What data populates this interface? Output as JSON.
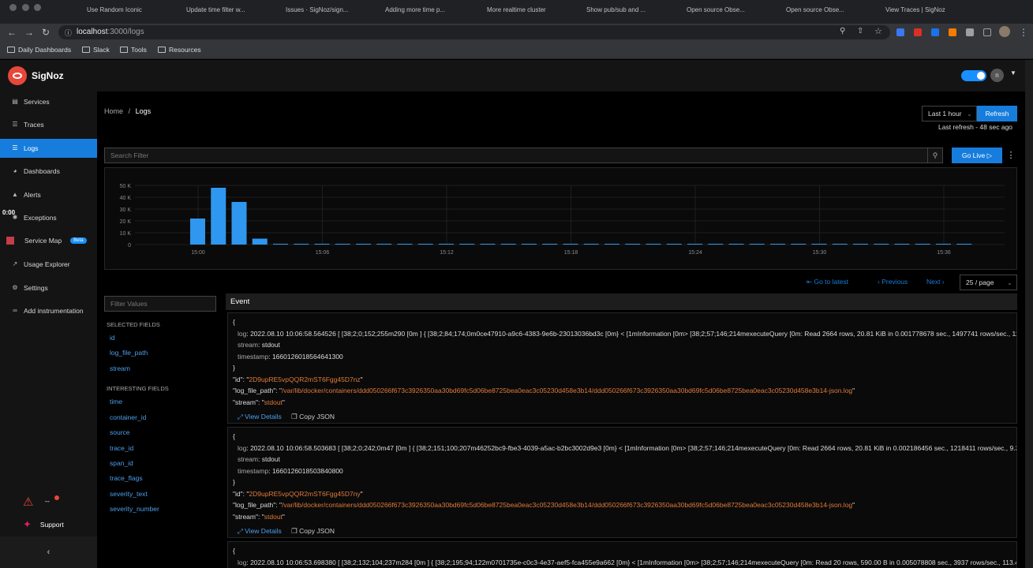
{
  "browser": {
    "tabs": [
      "Use Random Iconic",
      "Update time filter w...",
      "Issues · SigNoz/sign...",
      "Adding more time p...",
      "More realtime cluster",
      "Show pub/sub and ...",
      "Open source Obse...",
      "Open source Obse...",
      "View Traces | SigNoz"
    ],
    "url_host": "localhost",
    "url_path": ":3000/logs",
    "bookmarks": [
      "Daily Dashboards",
      "Slack",
      "Tools",
      "Resources"
    ]
  },
  "app": {
    "brand": "SigNoz",
    "nav": [
      {
        "label": "Services",
        "icon": "bar-chart-icon"
      },
      {
        "label": "Traces",
        "icon": "list-icon"
      },
      {
        "label": "Logs",
        "icon": "list-icon"
      },
      {
        "label": "Dashboards",
        "icon": "dashboard-icon"
      },
      {
        "label": "Alerts",
        "icon": "bell-icon"
      },
      {
        "label": "Exceptions",
        "icon": "bug-icon"
      },
      {
        "label": "Service Map",
        "icon": "map-icon",
        "badge": "Beta"
      },
      {
        "label": "Usage Explorer",
        "icon": "line-chart-icon"
      },
      {
        "label": "Settings",
        "icon": "settings-icon"
      },
      {
        "label": "Add instrumentation",
        "icon": "api-icon"
      }
    ],
    "active_nav": "Logs",
    "alert_status": "--",
    "support_label": "Support",
    "recording_time": "0:00",
    "avatar_initial": "n"
  },
  "header": {
    "breadcrumb_home": "Home",
    "breadcrumb_current": "Logs",
    "time_range": "Last 1 hour",
    "refresh_label": "Refresh",
    "last_refresh": "Last refresh - 48 sec ago"
  },
  "search": {
    "placeholder": "Search Filter",
    "go_live": "Go Live"
  },
  "chart_data": {
    "type": "bar",
    "y_ticks": [
      "50 K",
      "40 K",
      "30 K",
      "20 K",
      "10 K",
      "0"
    ],
    "x_ticks": [
      "15:00",
      "15:06",
      "15:12",
      "15:18",
      "15:24",
      "15:30",
      "15:36"
    ],
    "ylim": [
      0,
      50000
    ],
    "values": [
      22000,
      48000,
      36000,
      5000,
      500,
      500,
      500,
      500,
      500,
      500,
      500,
      500,
      500,
      500,
      500,
      500,
      500,
      500,
      500,
      500,
      500,
      500,
      500,
      500,
      500,
      500,
      500,
      500,
      500,
      500,
      500,
      500,
      500,
      500,
      500,
      500,
      500,
      500
    ],
    "color": "#2f97f0"
  },
  "pagination": {
    "go_to_latest": "Go to latest",
    "previous": "Previous",
    "next": "Next",
    "page_size": "25 / page"
  },
  "fields": {
    "filter_placeholder": "Filter Values",
    "selected_heading": "SELECTED FIELDS",
    "selected": [
      "id",
      "log_file_path",
      "stream"
    ],
    "interesting_heading": "INTERESTING FIELDS",
    "interesting": [
      "time",
      "container_id",
      "source",
      "trace_id",
      "span_id",
      "trace_flags",
      "severity_text",
      "severity_number"
    ]
  },
  "events": {
    "header": "Event",
    "view_details": "View Details",
    "copy_json": "Copy JSON",
    "items": [
      {
        "log": "2022.08.10 10:06:58.564526 [  [38;2;0;152;255m290 [0m ] { [38;2;84;174;0m0ce47910-a9c6-4383-9e6b-23013036bd3c [0m} < [1mInformation [0m>  [38;2;57;146;214mexecuteQuery [0m: Read 2664 rows, 20.81 KiB in 0.001778678 sec., 1497741 rows/sec., 11.43 MiB/sec.",
        "stream": "stdout",
        "timestamp": "1660126018564641300",
        "id": "2D9upRE5vpQQR2mST6Fgg45D7nz",
        "log_file_path": "/var/lib/docker/containers/ddd050266f673c3926350aa30bd69fc5d06be8725bea0eac3c05230d458e3b14/ddd050266f673c3926350aa30bd69fc5d06be8725bea0eac3c05230d458e3b14-json.log",
        "stream_val": "stdout"
      },
      {
        "log": "2022.08.10 10:06:58.503683 [  [38;2;0;242;0m47 [0m ] { [38;2;151;100;207m46252bc9-fbe3-4039-a5ac-b2bc3002d9e3 [0m} < [1mInformation [0m>  [38;2;57;146;214mexecuteQuery [0m: Read 2664 rows, 20.81 KiB in 0.002186456 sec., 1218411 rows/sec., 9.30 MiB/sec.",
        "stream": "stdout",
        "timestamp": "1660126018503840800",
        "id": "2D9upRE5vpQQR2mST6Fgg45D7ny",
        "log_file_path": "/var/lib/docker/containers/ddd050266f673c3926350aa30bd69fc5d06be8725bea0eac3c05230d458e3b14/ddd050266f673c3926350aa30bd69fc5d06be8725bea0eac3c05230d458e3b14-json.log",
        "stream_val": "stdout"
      },
      {
        "log": "2022.08.10 10:06:53.698380 [  [38;2;132;104;237m284 [0m ] { [38;2;195;94;122m0701735e-c0c3-4e37-aef5-fca455e9a662 [0m} < [1mInformation [0m>  [38;2;57;146;214mexecuteQuery [0m: Read 20 rows, 590.00 B in 0.005078808 sec., 3937 rows/sec., 113.45 KiB/sec."
      }
    ]
  }
}
